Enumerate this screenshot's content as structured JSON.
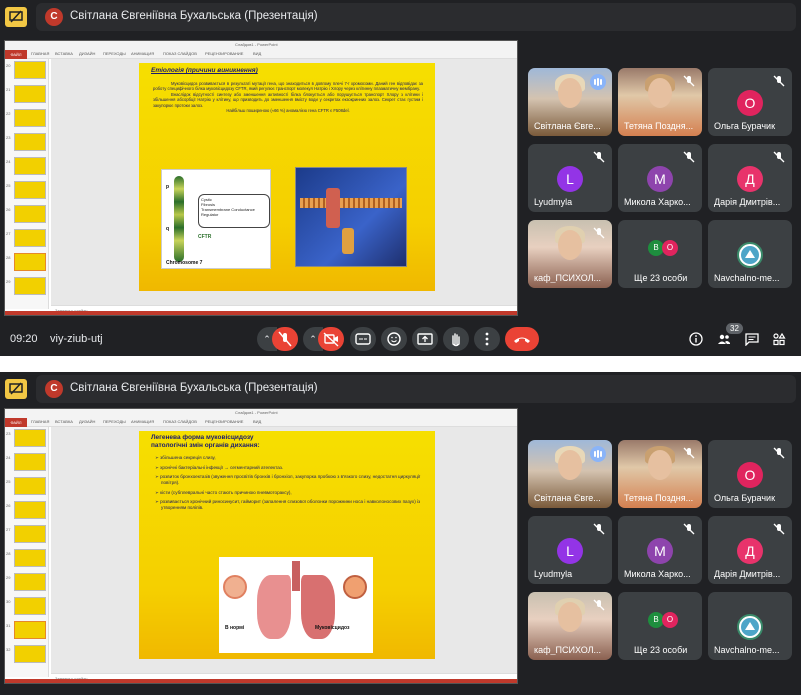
{
  "presenter": {
    "initial": "С",
    "title": "Світлана Євгеніївна Бухальська (Презентація)"
  },
  "ppt": {
    "file_tab": "ФАЙЛ",
    "tabs": [
      "ГЛАВНАЯ",
      "ВСТАВКА",
      "ДИЗАЙН",
      "ПЕРЕХОДЫ",
      "АНИМАЦИЯ",
      "ПОКАЗ СЛАЙДОВ",
      "РЕЦЕНЗИРОВАНИЕ",
      "ВИД"
    ],
    "window_title": "Слайдов1 - PowerPoint",
    "notes_placeholder": "Заметки к слайду",
    "thumb_numbers_1": [
      "20",
      "21",
      "22",
      "23",
      "24",
      "25",
      "26",
      "27",
      "28",
      "29"
    ],
    "thumb_numbers_2": [
      "23",
      "24",
      "25",
      "26",
      "27",
      "28",
      "29",
      "30",
      "31",
      "32"
    ]
  },
  "slide1": {
    "title": "Етіологія (причини виникнення)",
    "para1": "Муковісцидоз розвивається в результаті мутації гена, що знаходиться в довгому плечі 7-ї хромосоми. Даний ген відповідає за роботу специфічного білка муковісцидозу CFTR, який регулює транспорт молекул Натрію і Хлору через клітинну плазматичну мембрану.",
    "para2": "Внаслідок відсутності синтезу або зменшення активності білка блокується або порушується транспорт Хлору з клітини і збільшення абсорбції Натрію у клітину, що призводить до зменшення вмісту води у секретах екзокринних залоз. Секрет стає густим і закупорює протоки залоз.",
    "para3": "Найбільш поширеною (≈66 %) аномалією гена CFTR є F508del.",
    "gene_box": [
      "Cystic",
      "Fibrosis",
      "Transmembrane Conductance",
      "Regulator"
    ],
    "gene_label": "CFTR",
    "arm_p": "p",
    "arm_q": "q",
    "chromosome_label": "Chromosome 7"
  },
  "slide2": {
    "title_line1": "Легенева форма муковісцидозу",
    "title_line2": "патологічні змін органів дихання:",
    "items": [
      "➢ збільшена секреція слизу,",
      "➢ хронічні бактеріальні інфекції → сегментарний ателектаз.",
      "➢ розвиток бронхоектазів (звуження просвітів бронхів і бронхіол, закупорка пробкою з в'язкого слизу, недостатня циркуляції повітря).",
      "➢ кісти (субплевральні часто стають причиною пневмотораксу),",
      "➢ розвивається хронічний риносинусит, гайморит (запалення слизової оболонки порожнини носа і навколоносових пазух) із утворенням поліпів."
    ],
    "label_normal": "В нормі",
    "label_cf": "Муковісцидоз"
  },
  "participants": [
    {
      "name": "Світлана Євге...",
      "type": "photo",
      "speaking": true
    },
    {
      "name": "Тетяна Поздня...",
      "type": "photo2",
      "speaking": false
    },
    {
      "name": "Ольга Бурачик",
      "initial": "О",
      "color": "#e0245e"
    },
    {
      "name": "Lyudmyla",
      "initial": "L",
      "color": "#9334e6"
    },
    {
      "name": "Микола Харко...",
      "initial": "М",
      "color": "#8e44ad"
    },
    {
      "name": "Дарія Дмитрів...",
      "initial": "Д",
      "color": "#e8336b"
    },
    {
      "name": "каф_ПСИХОЛ...",
      "type": "photo3",
      "speaking": false
    },
    {
      "name": "Ще 23 особи",
      "type": "more"
    },
    {
      "name": "Navchalno-me...",
      "type": "logo"
    }
  ],
  "more_avatars": [
    {
      "initial": "В",
      "color": "#1e8e3e"
    },
    {
      "initial": "О",
      "color": "#e0245e"
    }
  ],
  "controls": {
    "time": "09:20",
    "meeting_code": "viy-ziub-utj",
    "participant_count": "32",
    "mic_muted": true,
    "camera_off": true
  },
  "colors": {
    "end_call": "#ea4335",
    "slide_yellow": "#f5d300",
    "meet_bg": "#202124"
  }
}
